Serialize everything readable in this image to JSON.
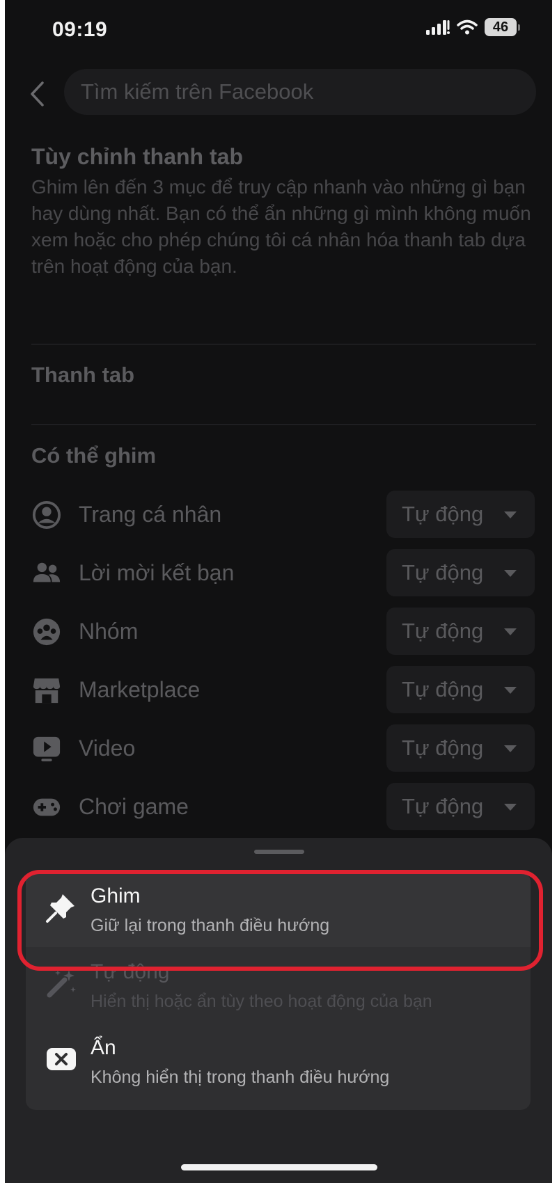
{
  "status_bar": {
    "time": "09:19",
    "battery": "46"
  },
  "search": {
    "placeholder": "Tìm kiếm trên Facebook"
  },
  "page": {
    "title": "Tùy chỉnh thanh tab",
    "description": "Ghim lên đến 3 mục để truy cập nhanh vào những gì bạn hay dùng nhất. Bạn có thể ẩn những gì mình không muốn xem hoặc cho phép chúng tôi cá nhân hóa thanh tab dựa trên hoạt động của bạn."
  },
  "sections": {
    "tab_bar": "Thanh tab",
    "pinnable": "Có thể ghim"
  },
  "pinnable_items": [
    {
      "label": "Trang cá nhân",
      "icon": "profile-icon",
      "value": "Tự động"
    },
    {
      "label": "Lời mời kết bạn",
      "icon": "friends-icon",
      "value": "Tự động"
    },
    {
      "label": "Nhóm",
      "icon": "groups-icon",
      "value": "Tự động"
    },
    {
      "label": "Marketplace",
      "icon": "marketplace-icon",
      "value": "Tự động"
    },
    {
      "label": "Video",
      "icon": "video-icon",
      "value": "Tự động"
    },
    {
      "label": "Chơi game",
      "icon": "gaming-icon",
      "value": "Tự động"
    }
  ],
  "sheet": {
    "options": [
      {
        "title": "Ghim",
        "subtitle": "Giữ lại trong thanh điều hướng",
        "icon": "pin-icon"
      },
      {
        "title": "Tự động",
        "subtitle": "Hiển thị hoặc ẩn tùy theo hoạt động của bạn",
        "icon": "magic-wand-icon"
      },
      {
        "title": "Ẩn",
        "subtitle": "Không hiển thị trong thanh điều hướng",
        "icon": "hide-icon"
      }
    ]
  },
  "colors": {
    "highlight": "#e02230",
    "background": "#111112",
    "sheet": "#242426"
  }
}
